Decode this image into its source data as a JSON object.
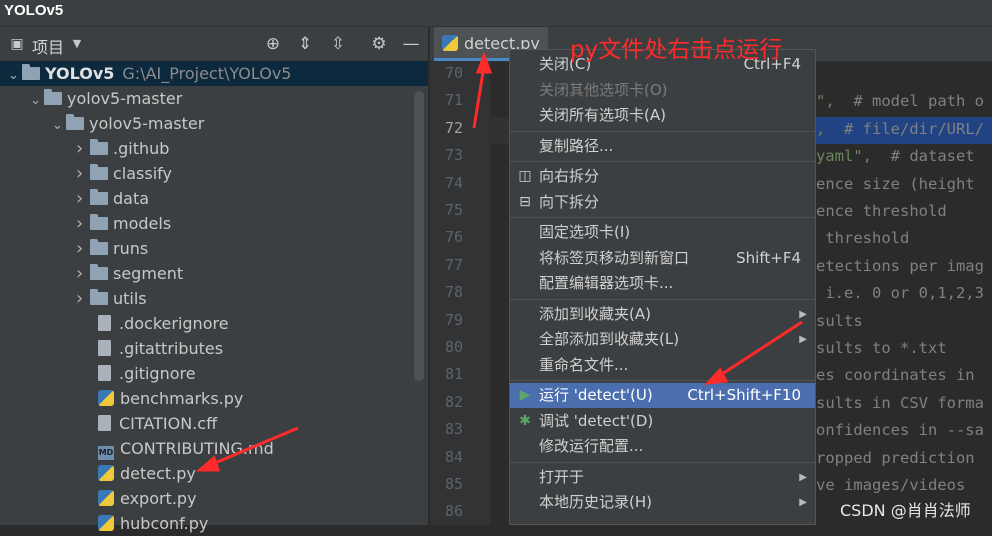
{
  "app": {
    "title": "YOLOv5"
  },
  "project_panel": {
    "label": "项目",
    "tree": [
      {
        "name": "YOLOv5",
        "path": "G:\\AI_Project\\YOLOv5",
        "kind": "folder",
        "expanded": true
      },
      {
        "name": "yolov5-master",
        "kind": "folder",
        "expanded": true
      },
      {
        "name": "yolov5-master",
        "kind": "folder",
        "expanded": true
      },
      {
        "name": ".github",
        "kind": "folder"
      },
      {
        "name": "classify",
        "kind": "folder"
      },
      {
        "name": "data",
        "kind": "folder"
      },
      {
        "name": "models",
        "kind": "folder"
      },
      {
        "name": "runs",
        "kind": "folder"
      },
      {
        "name": "segment",
        "kind": "folder"
      },
      {
        "name": "utils",
        "kind": "folder"
      },
      {
        "name": ".dockerignore",
        "kind": "file"
      },
      {
        "name": ".gitattributes",
        "kind": "file"
      },
      {
        "name": ".gitignore",
        "kind": "file"
      },
      {
        "name": "benchmarks.py",
        "kind": "py"
      },
      {
        "name": "CITATION.cff",
        "kind": "file"
      },
      {
        "name": "CONTRIBUTING.md",
        "kind": "md"
      },
      {
        "name": "detect.py",
        "kind": "py"
      },
      {
        "name": "export.py",
        "kind": "py"
      },
      {
        "name": "hubconf.py",
        "kind": "py"
      }
    ]
  },
  "editor": {
    "tab_label": "detect.py",
    "line_numbers": [
      "70",
      "71",
      "72",
      "73",
      "74",
      "75",
      "76",
      "77",
      "78",
      "79",
      "80",
      "81",
      "82",
      "83",
      "84",
      "85",
      "86"
    ],
    "current_line": "72",
    "code_lines": [
      "",
      "\",  # model path o",
      ",  # file/dir/URL/",
      "yaml\",  # dataset",
      "ence size (height",
      "ence threshold",
      " threshold",
      "etections per imag",
      " i.e. 0 or 0,1,2,3",
      "sults",
      "sults to *.txt",
      "es coordinates in",
      "sults in CSV forma",
      "onfidences in --sa",
      "ropped prediction",
      "ve images/videos",
      ""
    ]
  },
  "context_menu": {
    "items": [
      {
        "label": "关闭(C)",
        "shortcut": "Ctrl+F4"
      },
      {
        "label": "关闭其他选项卡(O)",
        "disabled": true
      },
      {
        "label": "关闭所有选项卡(A)"
      },
      {
        "label": "复制路径..."
      },
      {
        "label": "向右拆分",
        "icon": "split-right-icon"
      },
      {
        "label": "向下拆分",
        "icon": "split-down-icon"
      },
      {
        "label": "固定选项卡(I)"
      },
      {
        "label": "将标签页移动到新窗口",
        "shortcut": "Shift+F4"
      },
      {
        "label": "配置编辑器选项卡..."
      },
      {
        "label": "添加到收藏夹(A)",
        "submenu": true
      },
      {
        "label": "全部添加到收藏夹(L)",
        "submenu": true
      },
      {
        "label": "重命名文件..."
      },
      {
        "label": "运行 'detect'(U)",
        "shortcut": "Ctrl+Shift+F10",
        "icon": "run-icon",
        "active": true
      },
      {
        "label": "调试 'detect'(D)",
        "icon": "debug-icon"
      },
      {
        "label": "修改运行配置..."
      },
      {
        "label": "打开于",
        "submenu": true
      },
      {
        "label": "本地历史记录(H)",
        "submenu": true
      }
    ]
  },
  "annotation": {
    "text": "py文件处右击点运行"
  },
  "watermark": {
    "text": "CSDN @肖肖法师"
  },
  "colors": {
    "accent": "#4b6eaf",
    "annotation": "#ff2a2a",
    "run": "#59a869",
    "debug": "#59a869"
  }
}
